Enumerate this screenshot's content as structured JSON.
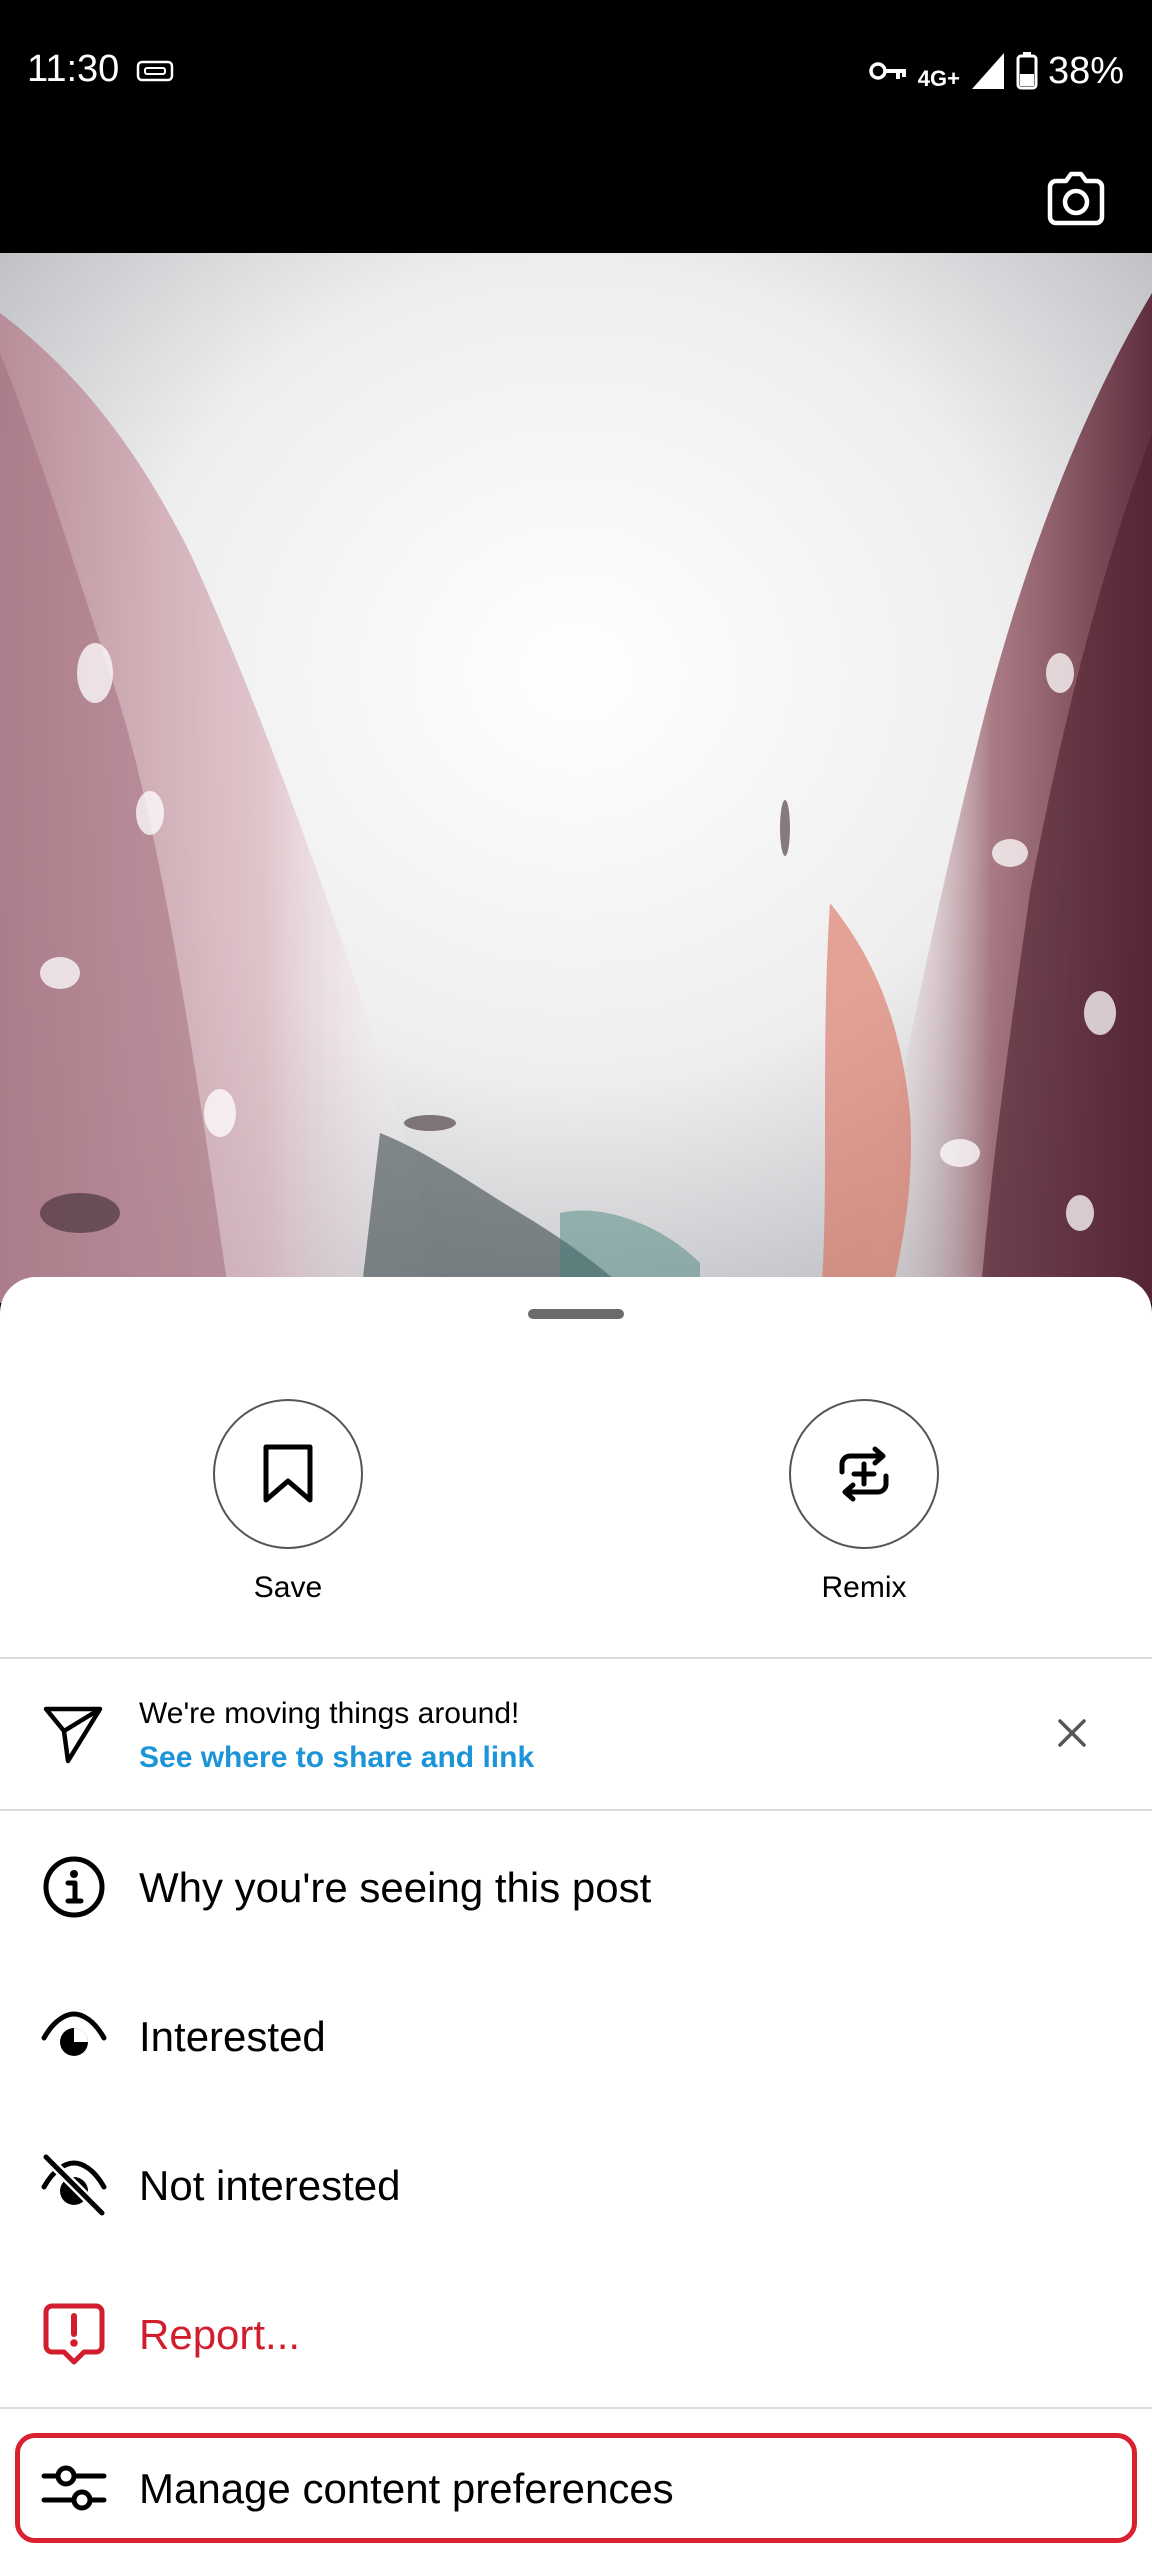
{
  "status_bar": {
    "time": "11:30",
    "network": "4G+",
    "battery": "38%"
  },
  "media": {
    "description_icon": "post-image"
  },
  "quick_actions": {
    "save_label": "Save",
    "remix_label": "Remix"
  },
  "notice": {
    "title": "We're moving things around!",
    "link": "See where to share and link"
  },
  "menu": {
    "why_label": "Why you're seeing this post",
    "interested_label": "Interested",
    "not_interested_label": "Not interested",
    "report_label": "Report...",
    "manage_label": "Manage content preferences"
  },
  "colors": {
    "link": "#1b95d8",
    "danger": "#d11d2e",
    "highlight": "#d8222e"
  }
}
